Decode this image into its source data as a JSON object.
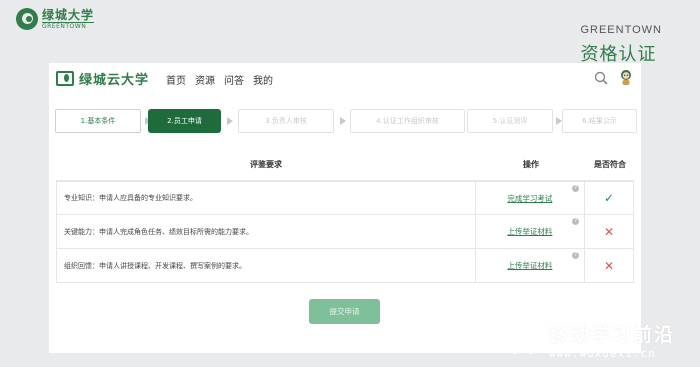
{
  "slide": {
    "logo_cn": "绿城大学",
    "logo_en": "GREENTOWN",
    "brand_en": "GREENTOWN",
    "brand_cn": "资格认证"
  },
  "app": {
    "title": "绿城云大学",
    "nav": [
      "首页",
      "资源",
      "问答",
      "我的"
    ],
    "icons": {
      "search": "search-icon",
      "avatar": "avatar-icon"
    }
  },
  "steps": [
    {
      "label": "1.基本条件",
      "state": "done"
    },
    {
      "label": "2.员工申请",
      "state": "active"
    },
    {
      "label": "3.负责人审核",
      "state": "todo"
    },
    {
      "label": "4.认证工作组织审核",
      "state": "todo"
    },
    {
      "label": "5.认证测评",
      "state": "todo"
    },
    {
      "label": "6.结果公示",
      "state": "todo"
    }
  ],
  "table": {
    "headers": {
      "requirement": "评鉴要求",
      "operation": "操作",
      "meets": "是否符合"
    },
    "rows": [
      {
        "requirement": "专业知识：申请人应具备的专业知识要求。",
        "action": "完成学习考试",
        "meets": true
      },
      {
        "requirement": "关键能力：申请人完成角色任务、绩效目标所需的能力要求。",
        "action": "上传举证材料",
        "meets": false
      },
      {
        "requirement": "组织回馈：申请人讲授课程、开发课程、撰写案例的要求。",
        "action": "上传举证材料",
        "meets": false
      }
    ],
    "help_glyph": "?",
    "check_glyph": "✓",
    "cross_glyph": "✕"
  },
  "submit_label": "提交申请",
  "watermark": {
    "cn": "移动学习前沿",
    "url": "www.wdxuexi.cn"
  },
  "colors": {
    "brand": "#2f7d4a",
    "active_step": "#1e6b3c",
    "submit": "#7fbf9a",
    "check": "#2f8a55",
    "cross": "#d8584e"
  }
}
